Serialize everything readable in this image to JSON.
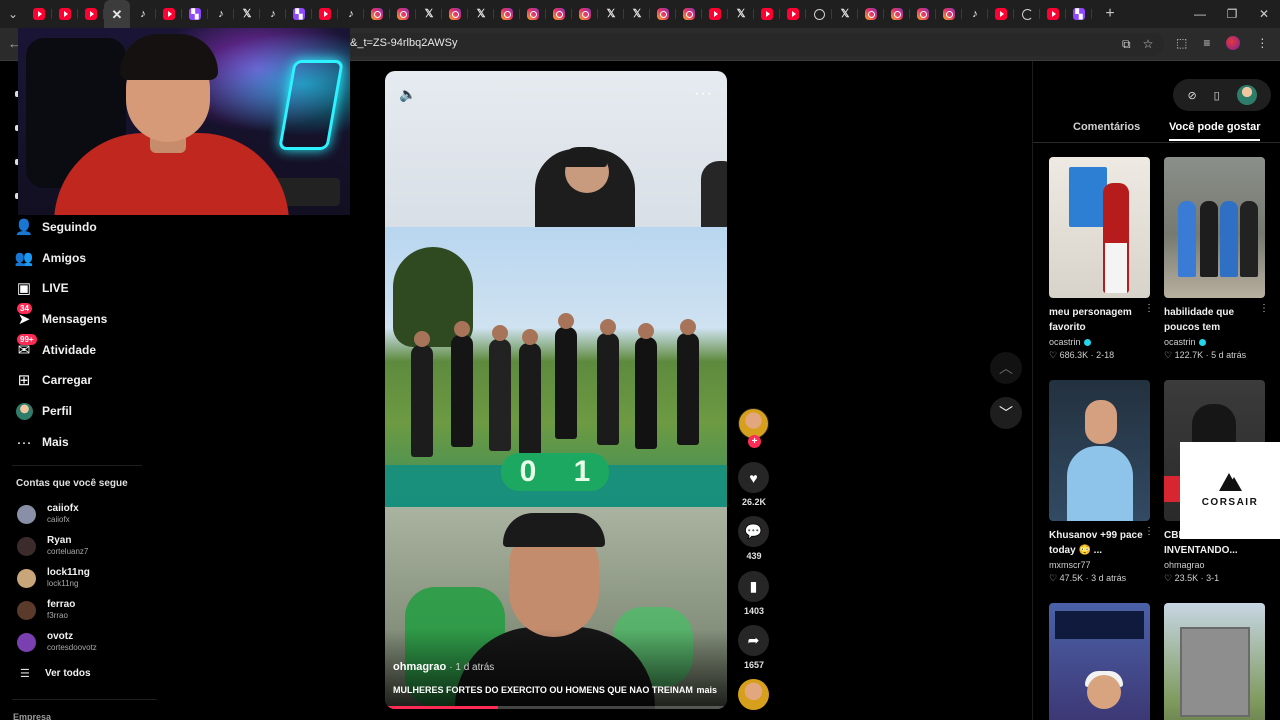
{
  "browser": {
    "tabs": [
      {
        "favicon": "youtube-icon"
      },
      {
        "favicon": "youtube-icon"
      },
      {
        "favicon": "youtube-icon"
      },
      {
        "favicon": "close-icon",
        "active": true
      },
      {
        "favicon": "tiktok-icon"
      },
      {
        "favicon": "youtube-icon"
      },
      {
        "favicon": "twitch-icon"
      },
      {
        "favicon": "tiktok-icon"
      },
      {
        "favicon": "x-icon"
      },
      {
        "favicon": "tiktok-icon"
      },
      {
        "favicon": "twitch-icon"
      },
      {
        "favicon": "youtube-icon"
      },
      {
        "favicon": "tiktok-icon"
      },
      {
        "favicon": "instagram-icon"
      },
      {
        "favicon": "instagram-icon"
      },
      {
        "favicon": "x-icon"
      },
      {
        "favicon": "instagram-icon"
      },
      {
        "favicon": "x-icon"
      },
      {
        "favicon": "instagram-icon"
      },
      {
        "favicon": "instagram-icon"
      },
      {
        "favicon": "instagram-icon"
      },
      {
        "favicon": "instagram-icon"
      },
      {
        "favicon": "x-icon"
      },
      {
        "favicon": "x-icon"
      },
      {
        "favicon": "instagram-icon"
      },
      {
        "favicon": "instagram-icon"
      },
      {
        "favicon": "youtube-icon"
      },
      {
        "favicon": "x-icon"
      },
      {
        "favicon": "youtube-icon"
      },
      {
        "favicon": "youtube-icon"
      },
      {
        "favicon": "threads-icon"
      },
      {
        "favicon": "x-icon"
      },
      {
        "favicon": "instagram-icon"
      },
      {
        "favicon": "instagram-icon"
      },
      {
        "favicon": "instagram-icon"
      },
      {
        "favicon": "instagram-icon"
      },
      {
        "favicon": "tiktok-icon"
      },
      {
        "favicon": "youtube-icon"
      },
      {
        "favicon": "swirl-icon"
      },
      {
        "favicon": "youtube-icon"
      },
      {
        "favicon": "twitch-icon"
      }
    ],
    "url": "&_t=ZS-94rlbq2AWSy"
  },
  "nav": {
    "items": [
      {
        "icon": "following-icon",
        "label": "Seguindo"
      },
      {
        "icon": "friends-icon",
        "label": "Amigos"
      },
      {
        "icon": "live-icon",
        "label": "LIVE"
      },
      {
        "icon": "messages-icon",
        "label": "Mensagens",
        "badge": "34"
      },
      {
        "icon": "activity-icon",
        "label": "Atividade",
        "badge": "99+"
      },
      {
        "icon": "upload-icon",
        "label": "Carregar"
      },
      {
        "icon": "profile-avatar",
        "label": "Perfil"
      },
      {
        "icon": "more-icon",
        "label": "Mais"
      }
    ],
    "following_title": "Contas que você segue",
    "accounts": [
      {
        "display": "caiiofx",
        "user": "caiiofx",
        "color": "#8a8fa8"
      },
      {
        "display": "Ryan",
        "user": "corteluanz7",
        "color": "#3b2b2b"
      },
      {
        "display": "lock11ng",
        "user": "lock11ng",
        "color": "#c9a57a"
      },
      {
        "display": "ferrao",
        "user": "f3rrao",
        "color": "#5a3a2a"
      },
      {
        "display": "ovotz",
        "user": "cortesdoovotz",
        "color": "#7a3fb0"
      }
    ],
    "see_all": "Ver todos",
    "footer_heading": "Empresa"
  },
  "video": {
    "author": "ohmagrao",
    "time": "· 1 d atrás",
    "caption": "MULHERES FORTES DO EXERCITO OU HOMENS QUE NAO TREINAM",
    "more_label": "mais",
    "scoreboard": [
      "0",
      "1"
    ],
    "progress": 0.33
  },
  "actions": {
    "likes": "26.2K",
    "comments": "439",
    "saves": "1403",
    "shares": "1657"
  },
  "right_panel": {
    "tabs": [
      "Comentários",
      "Você pode gostar"
    ],
    "active_tab": 1,
    "cards": [
      {
        "title": "meu personagem favorito",
        "author": "ocastrin",
        "verified": true,
        "likes": "686.3K",
        "date": "2-18"
      },
      {
        "title": "habilidade que poucos tem",
        "author": "ocastrin",
        "verified": true,
        "likes": "122.7K",
        "date": "5 d atrás"
      },
      {
        "title": "Khusanov +99 pace today 😳 ...",
        "author": "mxmscr77",
        "verified": false,
        "likes": "47.5K",
        "date": "3 d atrás"
      },
      {
        "title": "CBI... INVENTANDO...",
        "author": "ohmagrao",
        "verified": false,
        "likes": "23.5K",
        "date": "3-1"
      },
      {
        "title": "",
        "author": "",
        "likes": "",
        "date": ""
      },
      {
        "title": "",
        "author": "",
        "likes": "",
        "date": ""
      }
    ]
  },
  "ad": {
    "brand": "CORSAIR"
  },
  "colors": {
    "tiktok_red": "#fe2c55",
    "verified": "#20d5ec",
    "background": "#000000"
  }
}
